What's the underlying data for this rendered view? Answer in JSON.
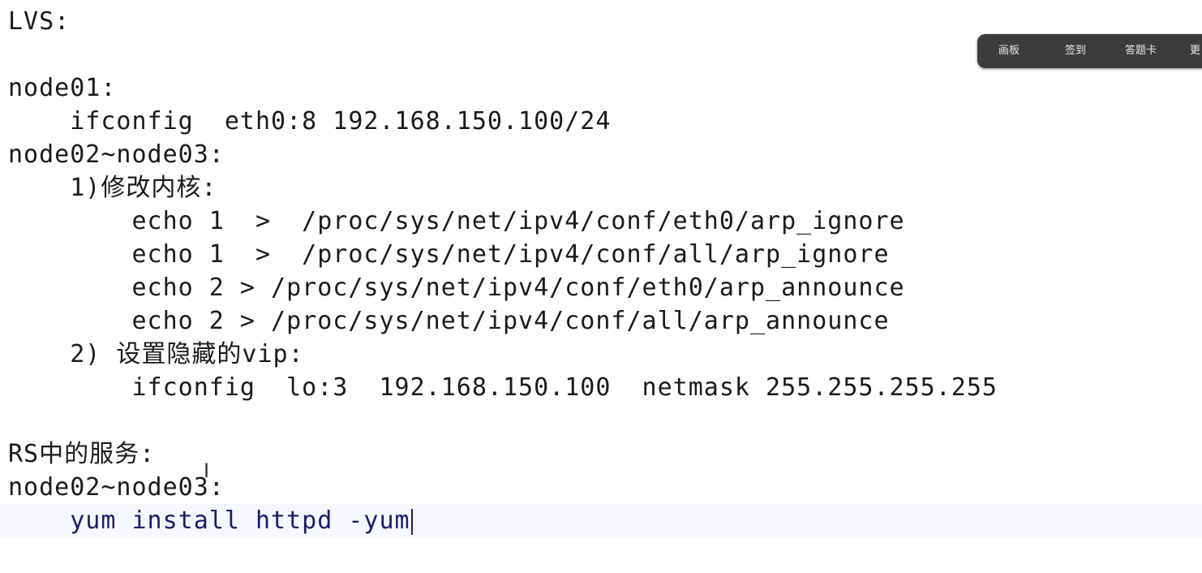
{
  "document": {
    "lines": [
      "LVS:",
      "",
      "node01:",
      "    ifconfig  eth0:8 192.168.150.100/24",
      "node02~node03:",
      "    1)修改内核:",
      "        echo 1  >  /proc/sys/net/ipv4/conf/eth0/arp_ignore",
      "        echo 1  >  /proc/sys/net/ipv4/conf/all/arp_ignore",
      "        echo 2 > /proc/sys/net/ipv4/conf/eth0/arp_announce",
      "        echo 2 > /proc/sys/net/ipv4/conf/all/arp_announce",
      "    2) 设置隐藏的vip:",
      "        ifconfig  lo:3  192.168.150.100  netmask 255.255.255.255",
      "",
      "RS中的服务:",
      "node02~node03:",
      "    yum install httpd -yum"
    ],
    "current_line": 15
  },
  "toolbar": {
    "items": [
      "画板",
      "签到",
      "答题卡",
      "更"
    ]
  }
}
